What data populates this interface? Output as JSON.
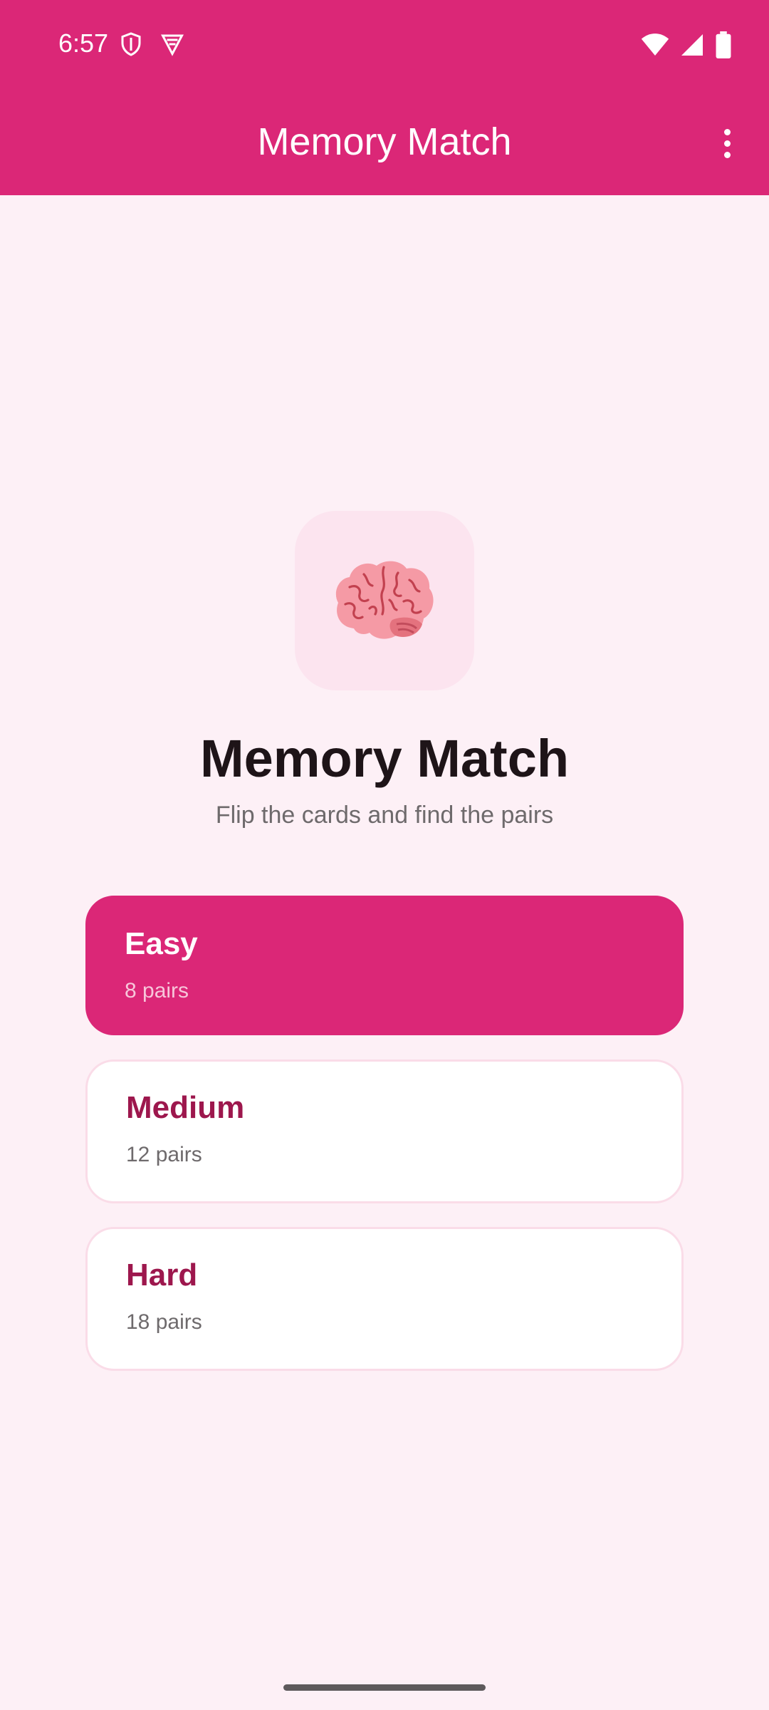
{
  "status_bar": {
    "time": "6:57",
    "icons": [
      "shield-icon",
      "vpn-icon",
      "wifi-icon",
      "signal-icon",
      "battery-icon"
    ]
  },
  "app_bar": {
    "title": "Memory Match",
    "menu_icon": "more-vert-icon"
  },
  "hero": {
    "icon": "brain-emoji",
    "emoji": "🧠",
    "title": "Memory Match",
    "subtitle": "Flip the cards and find the pairs"
  },
  "difficulties": [
    {
      "label": "Easy",
      "detail": "8 pairs",
      "selected": true
    },
    {
      "label": "Medium",
      "detail": "12 pairs",
      "selected": false
    },
    {
      "label": "Hard",
      "detail": "18 pairs",
      "selected": false
    }
  ],
  "colors": {
    "primary": "#DB2777",
    "background": "#FDF0F6",
    "title_on_card": "#9D174D",
    "tile": "#FCE4EF"
  }
}
